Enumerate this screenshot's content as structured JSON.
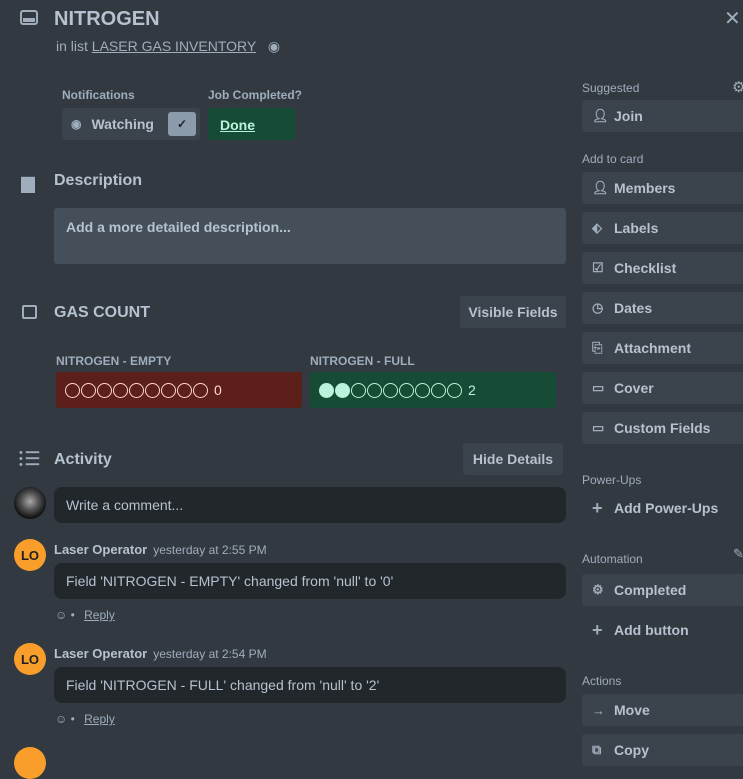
{
  "card": {
    "title": "NITROGEN",
    "in_list_prefix": "in list",
    "list_name": "LASER GAS INVENTORY"
  },
  "notifications": {
    "label": "Notifications",
    "button": "Watching"
  },
  "job": {
    "label": "Job Completed?",
    "value": "Done"
  },
  "description": {
    "heading": "Description",
    "placeholder": "Add a more detailed description..."
  },
  "gas_count": {
    "heading": "GAS COUNT",
    "visible_fields": "Visible Fields",
    "fields": [
      {
        "name": "NITROGEN - EMPTY",
        "filled": 0,
        "total": 9,
        "value": "0",
        "color": "#5d1f1a"
      },
      {
        "name": "NITROGEN - FULL",
        "filled": 2,
        "total": 9,
        "value": "2",
        "color": "#164b35"
      }
    ]
  },
  "activity": {
    "heading": "Activity",
    "hide_details": "Hide Details",
    "comment_placeholder": "Write a comment...",
    "items": [
      {
        "initials": "LO",
        "author": "Laser Operator",
        "time": "yesterday at 2:55 PM",
        "text": "Field 'NITROGEN - EMPTY' changed from 'null' to '0'",
        "reply": "Reply"
      },
      {
        "initials": "LO",
        "author": "Laser Operator",
        "time": "yesterday at 2:54 PM",
        "text": "Field 'NITROGEN - FULL' changed from 'null' to '2'",
        "reply": "Reply"
      }
    ]
  },
  "sidebar": {
    "suggested": "Suggested",
    "join": "Join",
    "add_to_card": "Add to card",
    "add_items": [
      "Members",
      "Labels",
      "Checklist",
      "Dates",
      "Attachment",
      "Cover",
      "Custom Fields"
    ],
    "power_ups": "Power-Ups",
    "add_power_ups": "Add Power-Ups",
    "automation": "Automation",
    "completed": "Completed",
    "add_button": "Add button",
    "actions": "Actions",
    "move": "Move",
    "copy": "Copy"
  }
}
